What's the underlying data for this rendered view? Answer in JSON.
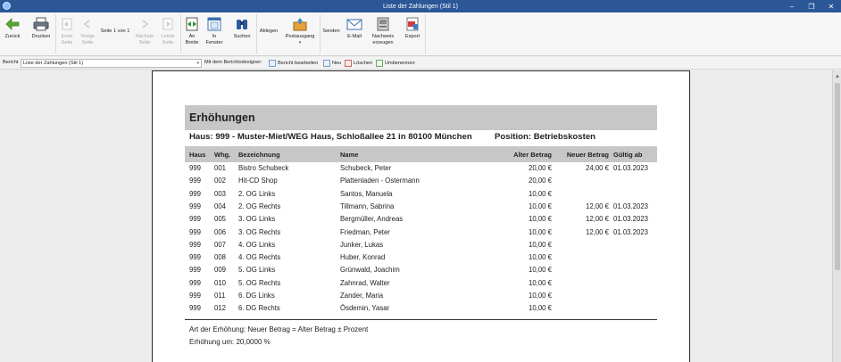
{
  "window": {
    "title": "Liste der Zahlungen (Stil 1)"
  },
  "ribbon": {
    "back": "Zurück",
    "print": "Drucken",
    "first_page": "Erste Seite",
    "prev_page": "Vorige Seite",
    "page_info": "Seite 1 von 1",
    "next_page": "Nächste Seite",
    "last_page": "Letzte Seite",
    "fit_width": "An Breite",
    "in_window": "In Fenster",
    "search": "Suchen",
    "file_label": "Ablegen",
    "mailbox": "Postausgang",
    "send_label": "Senden",
    "email": "E-Mail",
    "create_proof": "Nachweis erzeugen",
    "export": "Export"
  },
  "reportbar": {
    "label": "Bericht",
    "selected_report": "Liste der Zahlungen (Stil 1)",
    "designer_label": "Mit dem Berichtsdesigner:",
    "edit": "Bericht bearbeiten",
    "new": "Neu",
    "delete": "Löschen",
    "rename": "Umbenennen"
  },
  "report": {
    "title": "Erhöhungen",
    "house_line": "Haus: 999 - Muster-Miet/WEG Haus, Schloßallee 21 in 80100 München",
    "position_line": "Position: Betriebskosten",
    "columns": {
      "haus": "Haus",
      "whg": "Whg.",
      "bez": "Bezeichnung",
      "name": "Name",
      "alt": "Alter Betrag",
      "neu": "Neuer Betrag",
      "gueltig": "Gültig ab"
    },
    "rows": [
      {
        "haus": "999",
        "whg": "001",
        "bez": "Bistro Schubeck",
        "name": "Schubeck, Peter",
        "alt": "20,00 €",
        "neu": "24,00 €",
        "gueltig": "01.03.2023"
      },
      {
        "haus": "999",
        "whg": "002",
        "bez": "Hit-CD Shop",
        "name": "Plattenladen - Ostermann",
        "alt": "20,00 €",
        "neu": "",
        "gueltig": ""
      },
      {
        "haus": "999",
        "whg": "003",
        "bez": "2. OG Links",
        "name": "Santos, Manuela",
        "alt": "10,00 €",
        "neu": "",
        "gueltig": ""
      },
      {
        "haus": "999",
        "whg": "004",
        "bez": "2. OG Rechts",
        "name": "Tillmann, Sabrina",
        "alt": "10,00 €",
        "neu": "12,00 €",
        "gueltig": "01.03.2023"
      },
      {
        "haus": "999",
        "whg": "005",
        "bez": "3. OG Links",
        "name": "Bergmüller, Andreas",
        "alt": "10,00 €",
        "neu": "12,00 €",
        "gueltig": "01.03.2023"
      },
      {
        "haus": "999",
        "whg": "006",
        "bez": "3. OG Rechts",
        "name": "Friedman, Peter",
        "alt": "10,00 €",
        "neu": "12,00 €",
        "gueltig": "01.03.2023"
      },
      {
        "haus": "999",
        "whg": "007",
        "bez": "4. OG Links",
        "name": "Junker, Lukas",
        "alt": "10,00 €",
        "neu": "",
        "gueltig": ""
      },
      {
        "haus": "999",
        "whg": "008",
        "bez": "4. OG Rechts",
        "name": "Huber, Konrad",
        "alt": "10,00 €",
        "neu": "",
        "gueltig": ""
      },
      {
        "haus": "999",
        "whg": "009",
        "bez": "5. OG Links",
        "name": "Grünwald, Joachim",
        "alt": "10,00 €",
        "neu": "",
        "gueltig": ""
      },
      {
        "haus": "999",
        "whg": "010",
        "bez": "5. OG Rechts",
        "name": "Zahnrad, Walter",
        "alt": "10,00 €",
        "neu": "",
        "gueltig": ""
      },
      {
        "haus": "999",
        "whg": "011",
        "bez": "6. DG Links",
        "name": "Zander, Maria",
        "alt": "10,00 €",
        "neu": "",
        "gueltig": ""
      },
      {
        "haus": "999",
        "whg": "012",
        "bez": "6. DG Rechts",
        "name": "Ösdemin, Yasar",
        "alt": "10,00 €",
        "neu": "",
        "gueltig": ""
      }
    ],
    "footer_type": "Art der Erhöhung: Neuer Betrag = Alter Betrag ± Prozent",
    "footer_amount": "Erhöhung um: 20,0000 %"
  }
}
